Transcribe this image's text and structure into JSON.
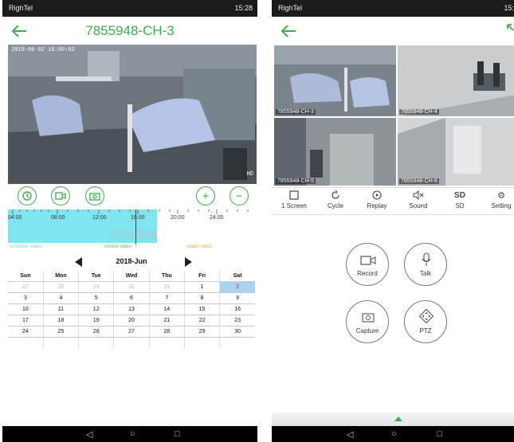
{
  "left": {
    "status": {
      "carrier": "RighTel",
      "time": "15:28"
    },
    "title": "7855948-CH-3",
    "video": {
      "timestamp": "2018-06-02   16:00:02",
      "watermark": "HD"
    },
    "timeline": {
      "ticks": [
        "04:00",
        "08:00",
        "12:00",
        "16:00",
        "20:00",
        "24:00"
      ],
      "date_watermark": "2 Jun 2018",
      "legend": {
        "schedule": "schedule video",
        "motion": "motion video",
        "alarm": "alarm video"
      }
    },
    "calendar": {
      "month": "2018-Jun",
      "weekdays": [
        "Sun",
        "Mon",
        "Tue",
        "Wed",
        "Thu",
        "Fri",
        "Sat"
      ],
      "weeks": [
        [
          "27",
          "28",
          "29",
          "30",
          "31",
          "1",
          "2"
        ],
        [
          "3",
          "4",
          "5",
          "6",
          "7",
          "8",
          "9"
        ],
        [
          "10",
          "11",
          "12",
          "13",
          "14",
          "15",
          "16"
        ],
        [
          "17",
          "18",
          "19",
          "20",
          "21",
          "22",
          "23"
        ],
        [
          "24",
          "25",
          "26",
          "27",
          "28",
          "29",
          "30"
        ]
      ],
      "selected_day": "2"
    },
    "icons": [
      "clock-icon",
      "record-icon",
      "snapshot-icon",
      "zoom-in-icon",
      "zoom-out-icon"
    ]
  },
  "right": {
    "status": {
      "carrier": "RighTel",
      "time": "15:26"
    },
    "cells": [
      "7855948-CH-3",
      "7855948-CH-4",
      "7855948-CH-5",
      "7855948-CH-6"
    ],
    "toolbar": [
      {
        "icon": "square-icon",
        "label": "1 Screen"
      },
      {
        "icon": "cycle-icon",
        "label": "Cycle"
      },
      {
        "icon": "replay-icon",
        "label": "Replay"
      },
      {
        "icon": "mute-icon",
        "label": "Sound"
      },
      {
        "icon": "sd-icon",
        "label": "SD",
        "top": "SD"
      },
      {
        "icon": "gear-icon",
        "label": "Setting"
      }
    ],
    "actions": {
      "record": "Record",
      "talk": "Talk",
      "capture": "Capture",
      "ptz": "PTZ"
    }
  },
  "colors": {
    "accent": "#3dae4d",
    "timeline": "#7fe4ef",
    "selected": "#a9d3f0",
    "schedule": "#7fd3e0",
    "motion": "#6bbf5a",
    "alarm": "#e8b532"
  }
}
